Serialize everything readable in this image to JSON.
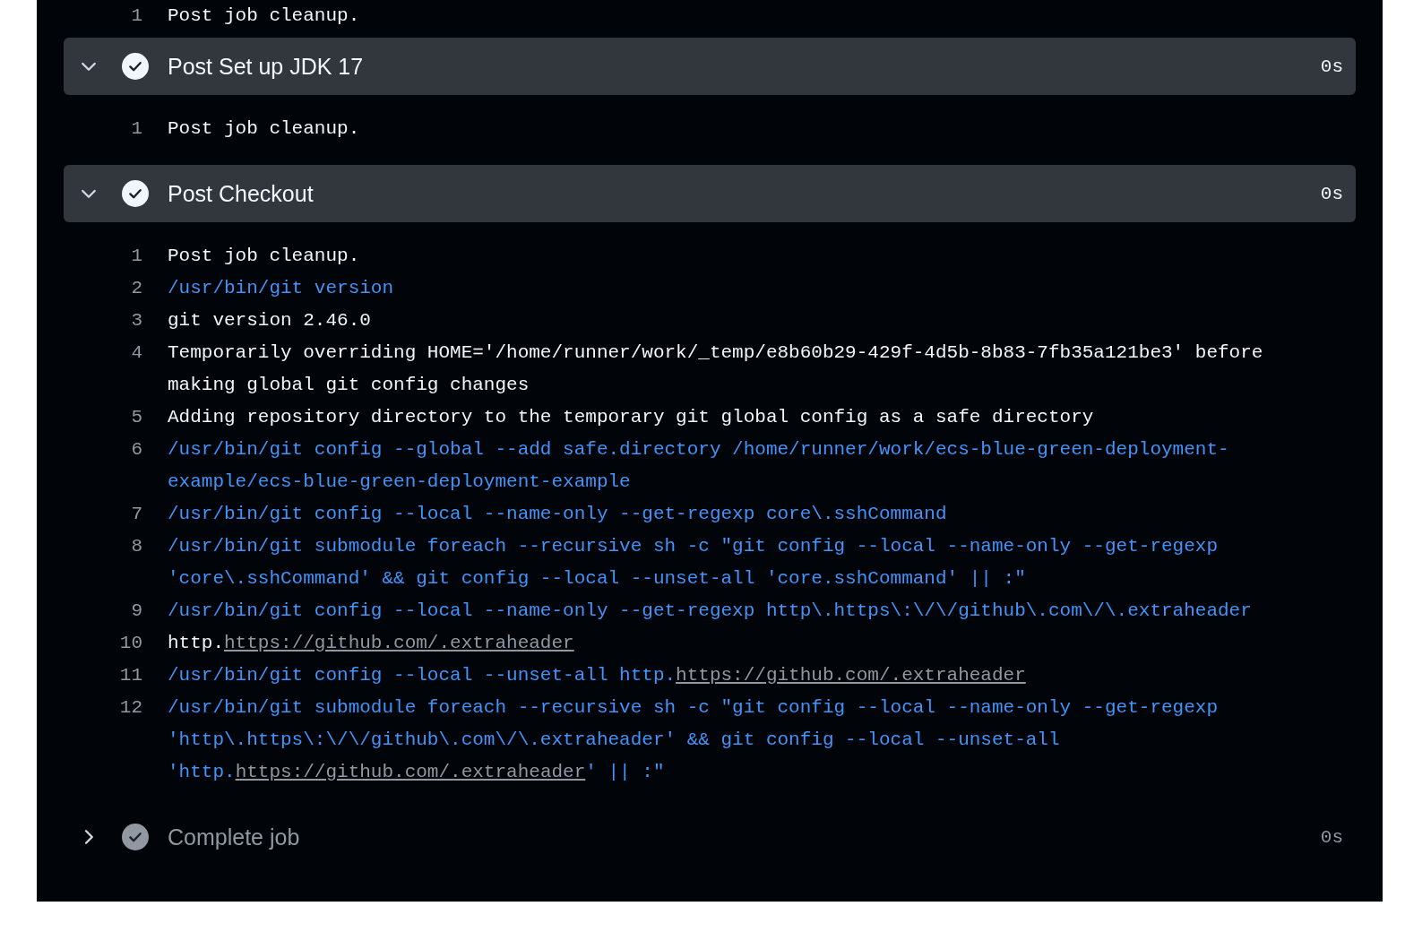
{
  "previous_step_tail": [
    {
      "number": "1",
      "segments": [
        {
          "kind": "plain",
          "text": "Post job cleanup."
        }
      ]
    }
  ],
  "steps": [
    {
      "title": "Post Set up JDK 17",
      "duration": "0s",
      "expanded": true,
      "lines": [
        {
          "number": "1",
          "segments": [
            {
              "kind": "plain",
              "text": "Post job cleanup."
            }
          ]
        }
      ]
    },
    {
      "title": "Post Checkout",
      "duration": "0s",
      "expanded": true,
      "lines": [
        {
          "number": "1",
          "segments": [
            {
              "kind": "plain",
              "text": "Post job cleanup."
            }
          ]
        },
        {
          "number": "2",
          "segments": [
            {
              "kind": "command",
              "text": "/usr/bin/git version"
            }
          ]
        },
        {
          "number": "3",
          "segments": [
            {
              "kind": "plain",
              "text": "git version 2.46.0"
            }
          ]
        },
        {
          "number": "4",
          "segments": [
            {
              "kind": "plain",
              "text": "Temporarily overriding HOME='/home/runner/work/_temp/e8b60b29-429f-4d5b-8b83-7fb35a121be3' before making global git config changes"
            }
          ]
        },
        {
          "number": "5",
          "segments": [
            {
              "kind": "plain",
              "text": "Adding repository directory to the temporary git global config as a safe directory"
            }
          ]
        },
        {
          "number": "6",
          "segments": [
            {
              "kind": "command",
              "text": "/usr/bin/git config --global --add safe.directory /home/runner/work/ecs-blue-green-deployment-example/ecs-blue-green-deployment-example"
            }
          ]
        },
        {
          "number": "7",
          "segments": [
            {
              "kind": "command",
              "text": "/usr/bin/git config --local --name-only --get-regexp core\\.sshCommand"
            }
          ]
        },
        {
          "number": "8",
          "segments": [
            {
              "kind": "command",
              "text": "/usr/bin/git submodule foreach --recursive sh -c \"git config --local --name-only --get-regexp 'core\\.sshCommand' && git config --local --unset-all 'core.sshCommand' || :\""
            }
          ]
        },
        {
          "number": "9",
          "segments": [
            {
              "kind": "command",
              "text": "/usr/bin/git config --local --name-only --get-regexp http\\.https\\:\\/\\/github\\.com\\/\\.extraheader"
            }
          ]
        },
        {
          "number": "10",
          "segments": [
            {
              "kind": "plain",
              "text": "http."
            },
            {
              "kind": "link",
              "text": "https://github.com/.extraheader"
            }
          ]
        },
        {
          "number": "11",
          "segments": [
            {
              "kind": "command",
              "text": "/usr/bin/git config --local --unset-all http."
            },
            {
              "kind": "link",
              "text": "https://github.com/.extraheader"
            }
          ]
        },
        {
          "number": "12",
          "segments": [
            {
              "kind": "command",
              "text": "/usr/bin/git submodule foreach --recursive sh -c \"git config --local --name-only --get-regexp 'http\\.https\\:\\/\\/github\\.com\\/\\.extraheader' && git config --local --unset-all 'http."
            },
            {
              "kind": "link",
              "text": "https://github.com/.extraheader"
            },
            {
              "kind": "command",
              "text": "' || :\""
            }
          ]
        }
      ]
    },
    {
      "title": "Complete job",
      "duration": "0s",
      "expanded": false
    }
  ]
}
